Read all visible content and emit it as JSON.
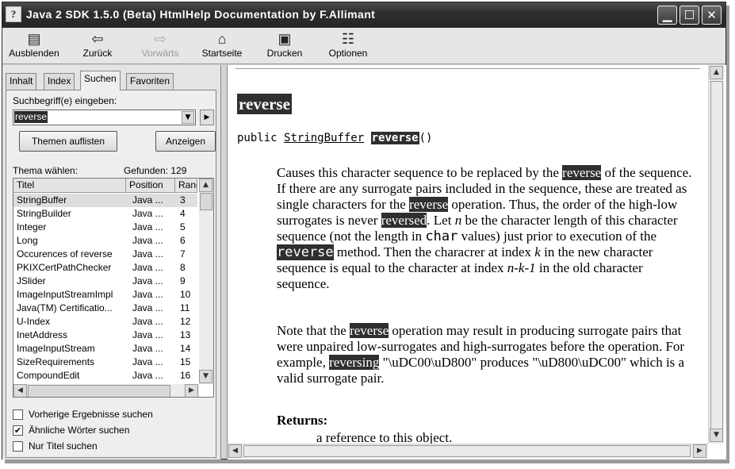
{
  "window": {
    "title": "Java 2 SDK 1.5.0 (Beta) HtmlHelp Documentation by F.Allimant",
    "icon": "help-question-icon",
    "controls": {
      "minimize": "minimize-icon",
      "maximize": "maximize-icon",
      "close": "close-icon"
    }
  },
  "toolbar": {
    "items": [
      {
        "label": "Ausblenden",
        "icon": "hide-pane-icon",
        "enabled": true
      },
      {
        "label": "Zurück",
        "icon": "arrow-left-icon",
        "enabled": true
      },
      {
        "label": "Vorwärts",
        "icon": "arrow-right-icon",
        "enabled": false
      },
      {
        "label": "Startseite",
        "icon": "home-icon",
        "enabled": true
      },
      {
        "label": "Drucken",
        "icon": "printer-icon",
        "enabled": true
      },
      {
        "label": "Optionen",
        "icon": "options-icon",
        "enabled": true
      }
    ]
  },
  "tabs": [
    {
      "label": "Inhalt"
    },
    {
      "label": "Index"
    },
    {
      "label": "Suchen",
      "active": true
    },
    {
      "label": "Favoriten"
    }
  ],
  "search": {
    "prompt": "Suchbegriff(e) eingeben:",
    "value": "reverse",
    "list_topics_button": "Themen auflisten",
    "show_button": "Anzeigen",
    "select_topic_label": "Thema wählen:",
    "found_label": "Gefunden: 129",
    "columns": [
      "Titel",
      "Position",
      "Rang"
    ],
    "results": [
      {
        "title": "StringBuffer",
        "position": "Java ...",
        "rank": "3",
        "selected": true
      },
      {
        "title": "StringBuilder",
        "position": "Java ...",
        "rank": "4"
      },
      {
        "title": "Integer",
        "position": "Java ...",
        "rank": "5"
      },
      {
        "title": "Long",
        "position": "Java ...",
        "rank": "6"
      },
      {
        "title": "Occurences of reverse",
        "position": "Java ...",
        "rank": "7"
      },
      {
        "title": "PKIXCertPathChecker",
        "position": "Java ...",
        "rank": "8"
      },
      {
        "title": "JSlider",
        "position": "Java ...",
        "rank": "9"
      },
      {
        "title": "ImageInputStreamImpl",
        "position": "Java ...",
        "rank": "10"
      },
      {
        "title": "Java(TM) Certificatio...",
        "position": "Java ...",
        "rank": "11"
      },
      {
        "title": "U-Index",
        "position": "Java ...",
        "rank": "12"
      },
      {
        "title": "InetAddress",
        "position": "Java ...",
        "rank": "13"
      },
      {
        "title": "ImageInputStream",
        "position": "Java ...",
        "rank": "14"
      },
      {
        "title": "SizeRequirements",
        "position": "Java ...",
        "rank": "15"
      },
      {
        "title": "CompoundEdit",
        "position": "Java ...",
        "rank": "16"
      }
    ],
    "options": [
      {
        "label": "Vorherige Ergebnisse suchen",
        "checked": false
      },
      {
        "label": "Ähnliche Wörter suchen",
        "checked": true
      },
      {
        "label": "Nur Titel suchen",
        "checked": false
      }
    ]
  },
  "doc": {
    "heading": "reverse",
    "signature": {
      "prefix": "public ",
      "type": "StringBuffer",
      "method": "reverse",
      "suffix": "()"
    },
    "para1": [
      {
        "t": "Causes this character sequence to be replaced by the "
      },
      {
        "t": "reverse",
        "hl": true
      },
      {
        "t": " of the sequence. If there are any surrogate pairs included in the sequence, these are treated as single characters for the "
      },
      {
        "t": "reverse",
        "hl": true
      },
      {
        "t": " operation. Thus, the order of the high-low surrogates is never "
      },
      {
        "t": "reversed",
        "hl": true
      },
      {
        "t": ". Let "
      },
      {
        "t": "n",
        "i": true
      },
      {
        "t": " be the character length of this character sequence (not the length in "
      },
      {
        "t": "char",
        "mono": true
      },
      {
        "t": " values) just prior to execution of the "
      },
      {
        "t": "reverse",
        "hl": true,
        "mono": true
      },
      {
        "t": " method. Then the characrer at index "
      },
      {
        "t": "k",
        "i": true
      },
      {
        "t": " in the new character sequence is equal to the character at index "
      },
      {
        "t": "n-k-1",
        "i": true
      },
      {
        "t": " in the old character sequence."
      }
    ],
    "para2": [
      {
        "t": "Note that the "
      },
      {
        "t": "reverse",
        "hl": true
      },
      {
        "t": " operation may result in producing surrogate pairs that were unpaired low-surrogates and high-surrogates before the operation. For example, "
      },
      {
        "t": "reversing",
        "hl": true
      },
      {
        "t": " \"\\uDC00\\uD800\" produces \"\\uD800\\uDC00\" which is a valid surrogate pair."
      }
    ],
    "returns_label": "Returns:",
    "returns_text": "a reference to this object."
  }
}
